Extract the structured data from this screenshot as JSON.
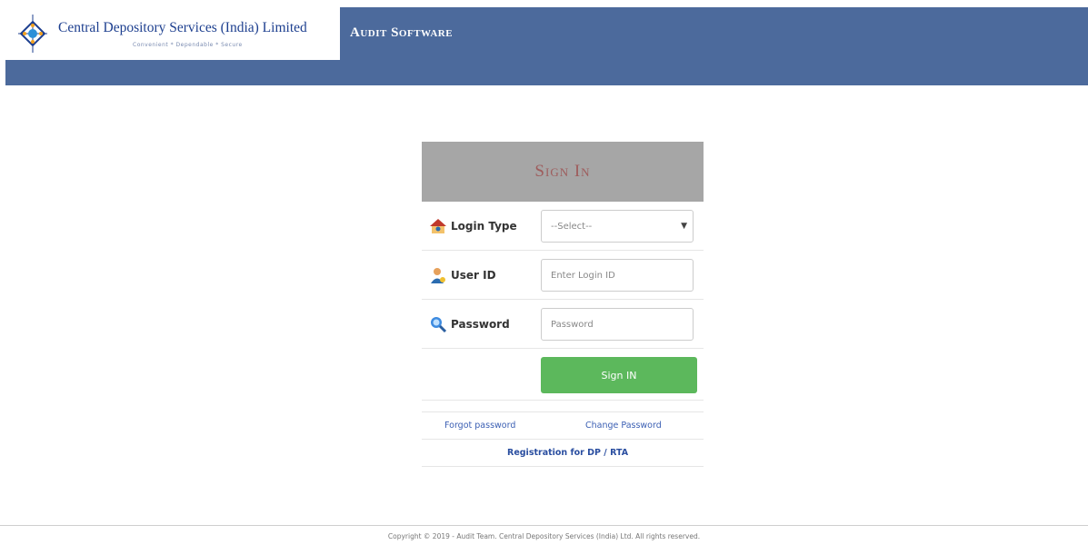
{
  "header": {
    "brand": "Central Depository Services (India) Limited",
    "tagline": "Convenient  *  Dependable  *  Secure",
    "app_title": "Audit Software",
    "color": "#4c6a9c"
  },
  "login": {
    "title": "Sign In",
    "login_type_label": "Login Type",
    "login_type_value": "--Select--",
    "user_id_label": "User ID",
    "user_id_placeholder": "Enter Login ID",
    "password_label": "Password",
    "password_placeholder": "Password",
    "submit_label": "Sign IN",
    "forgot_password": "Forgot password",
    "change_password": "Change Password",
    "registration": "Registration for DP / RTA",
    "submit_color": "#5cb85c"
  },
  "footer": {
    "copyright": "Copyright © 2019 - Audit Team. Central Depository Services (India) Ltd. All rights reserved."
  }
}
